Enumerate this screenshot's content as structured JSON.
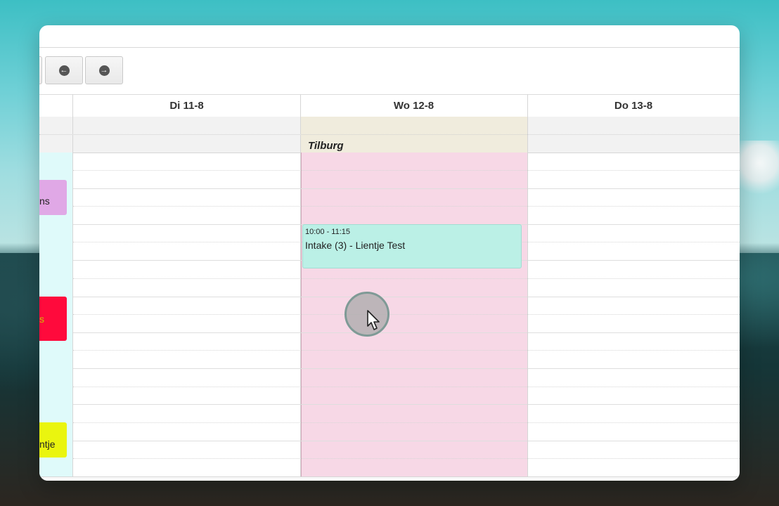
{
  "toolbar": {
    "prev_icon": "arrow-left-circle",
    "next_icon": "arrow-right-circle",
    "prev_glyph": "←",
    "next_glyph": "→"
  },
  "calendar": {
    "days": [
      {
        "label": "Di 11-8"
      },
      {
        "label": "Wo 12-8"
      },
      {
        "label": "Do 13-8"
      }
    ],
    "location_label": "Tilburg",
    "event": {
      "time": "10:00 - 11:15",
      "title": "Intake (3) - Lientje Test",
      "color": "#bbf0e6"
    },
    "side_events": [
      {
        "text": "ns",
        "color": "#e0a8e6"
      },
      {
        "text": "s",
        "color": "#ff0a3c"
      },
      {
        "text": "ntje",
        "color": "#eaf50f"
      }
    ],
    "highlight_color": "#f7d8e6"
  }
}
